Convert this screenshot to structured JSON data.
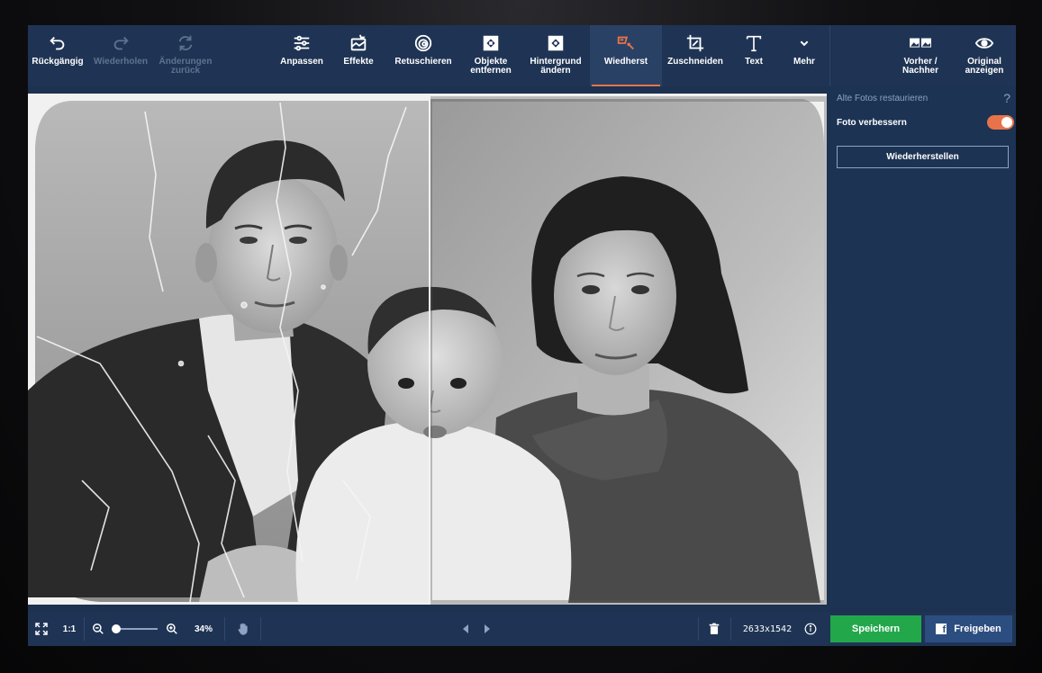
{
  "toolbar": {
    "undo": "Rückgängig",
    "redo": "Wiederholen",
    "revert": "Änderungen\nzurück",
    "adjust": "Anpassen",
    "effects": "Effekte",
    "retouch": "Retuschieren",
    "remove_objects": "Objekte\nentfernen",
    "change_background": "Hintergrund\nändern",
    "restore": "Wiedherst",
    "crop": "Zuschneiden",
    "text": "Text",
    "more": "Mehr",
    "before_after": "Vorher /\nNachher",
    "show_original": "Original\nanzeigen"
  },
  "panel": {
    "section_title": "Alte Fotos restaurieren",
    "help": "?",
    "enhance_label": "Foto verbessern",
    "enhance_on": true,
    "restore_button": "Wiederherstellen"
  },
  "status": {
    "ratio": "1:1",
    "zoom": "34%",
    "dimensions": "2633x1542",
    "save": "Speichern",
    "share": "Freigeben"
  },
  "colors": {
    "accent": "#e8734a",
    "save_green": "#22a84b",
    "toolbar_bg": "#1f3454",
    "panel_bg": "#1c3354"
  }
}
